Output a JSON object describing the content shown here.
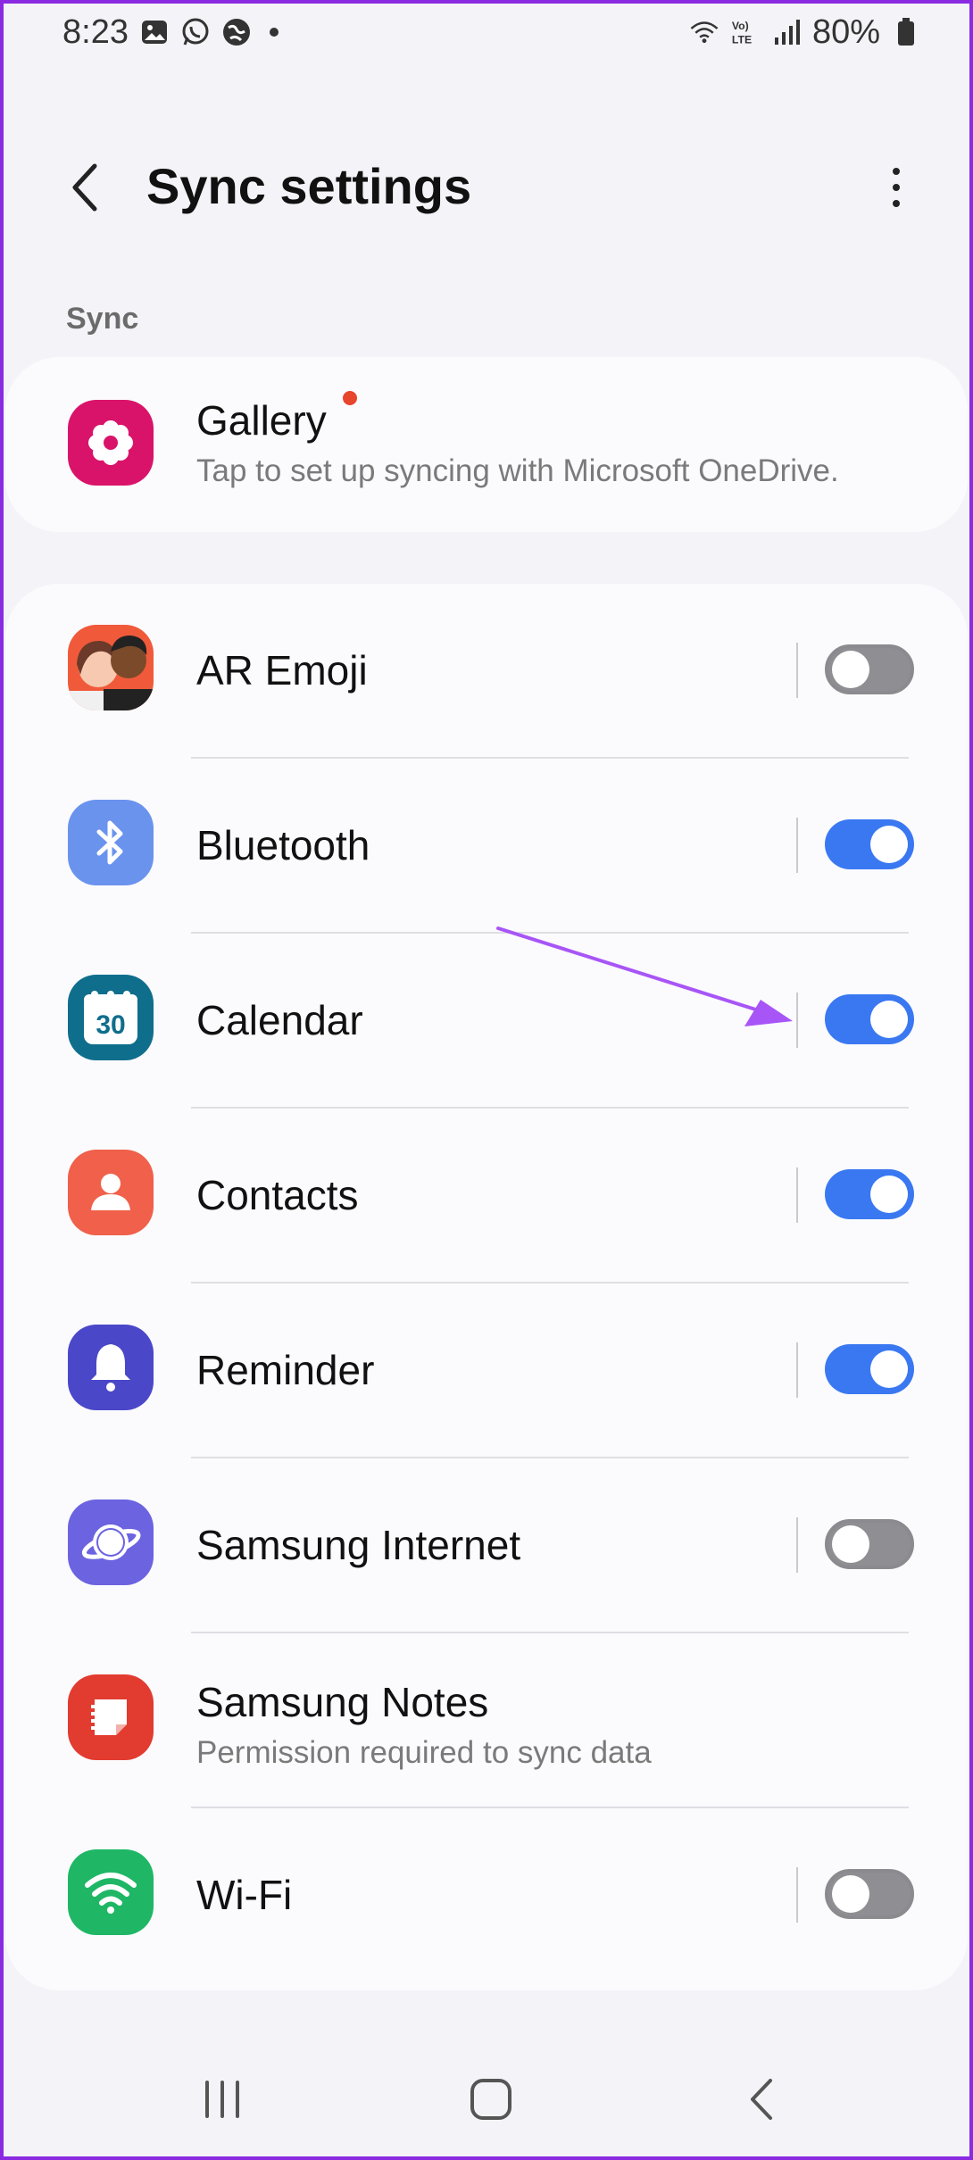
{
  "status_bar": {
    "time": "8:23",
    "battery": "80%",
    "icons": [
      "gallery-notification-icon",
      "whatsapp-icon",
      "vpn-globe-icon",
      "dot-icon",
      "wifi-calling-icon",
      "volte-icon",
      "signal-icon",
      "battery-icon"
    ]
  },
  "header": {
    "title": "Sync settings",
    "back_icon": "chevron-left-icon",
    "more_icon": "more-vertical-icon"
  },
  "section": {
    "label": "Sync"
  },
  "gallery": {
    "title": "Gallery",
    "subtitle": "Tap to set up syncing with Microsoft OneDrive.",
    "badge_color": "#e8452d",
    "icon": "gallery-flower-icon"
  },
  "apps": [
    {
      "title": "AR Emoji",
      "enabled": false,
      "icon": "ar-emoji-icon"
    },
    {
      "title": "Bluetooth",
      "enabled": true,
      "icon": "bluetooth-icon"
    },
    {
      "title": "Calendar",
      "enabled": true,
      "icon": "calendar-icon",
      "icon_text": "30"
    },
    {
      "title": "Contacts",
      "enabled": true,
      "icon": "contacts-icon"
    },
    {
      "title": "Reminder",
      "enabled": true,
      "icon": "reminder-bell-icon"
    },
    {
      "title": "Samsung Internet",
      "enabled": false,
      "icon": "samsung-internet-icon"
    },
    {
      "title": "Samsung Notes",
      "subtitle": "Permission required to sync data",
      "icon": "samsung-notes-icon"
    },
    {
      "title": "Wi-Fi",
      "enabled": false,
      "icon": "wifi-icon"
    }
  ],
  "colors": {
    "toggle_on": "#3a78f2",
    "toggle_off": "#8f8f93",
    "annotation_arrow": "#a855f7",
    "frame": "#8a2be2"
  },
  "nav_bar": {
    "icons": [
      "recents-icon",
      "home-icon",
      "back-icon"
    ]
  }
}
